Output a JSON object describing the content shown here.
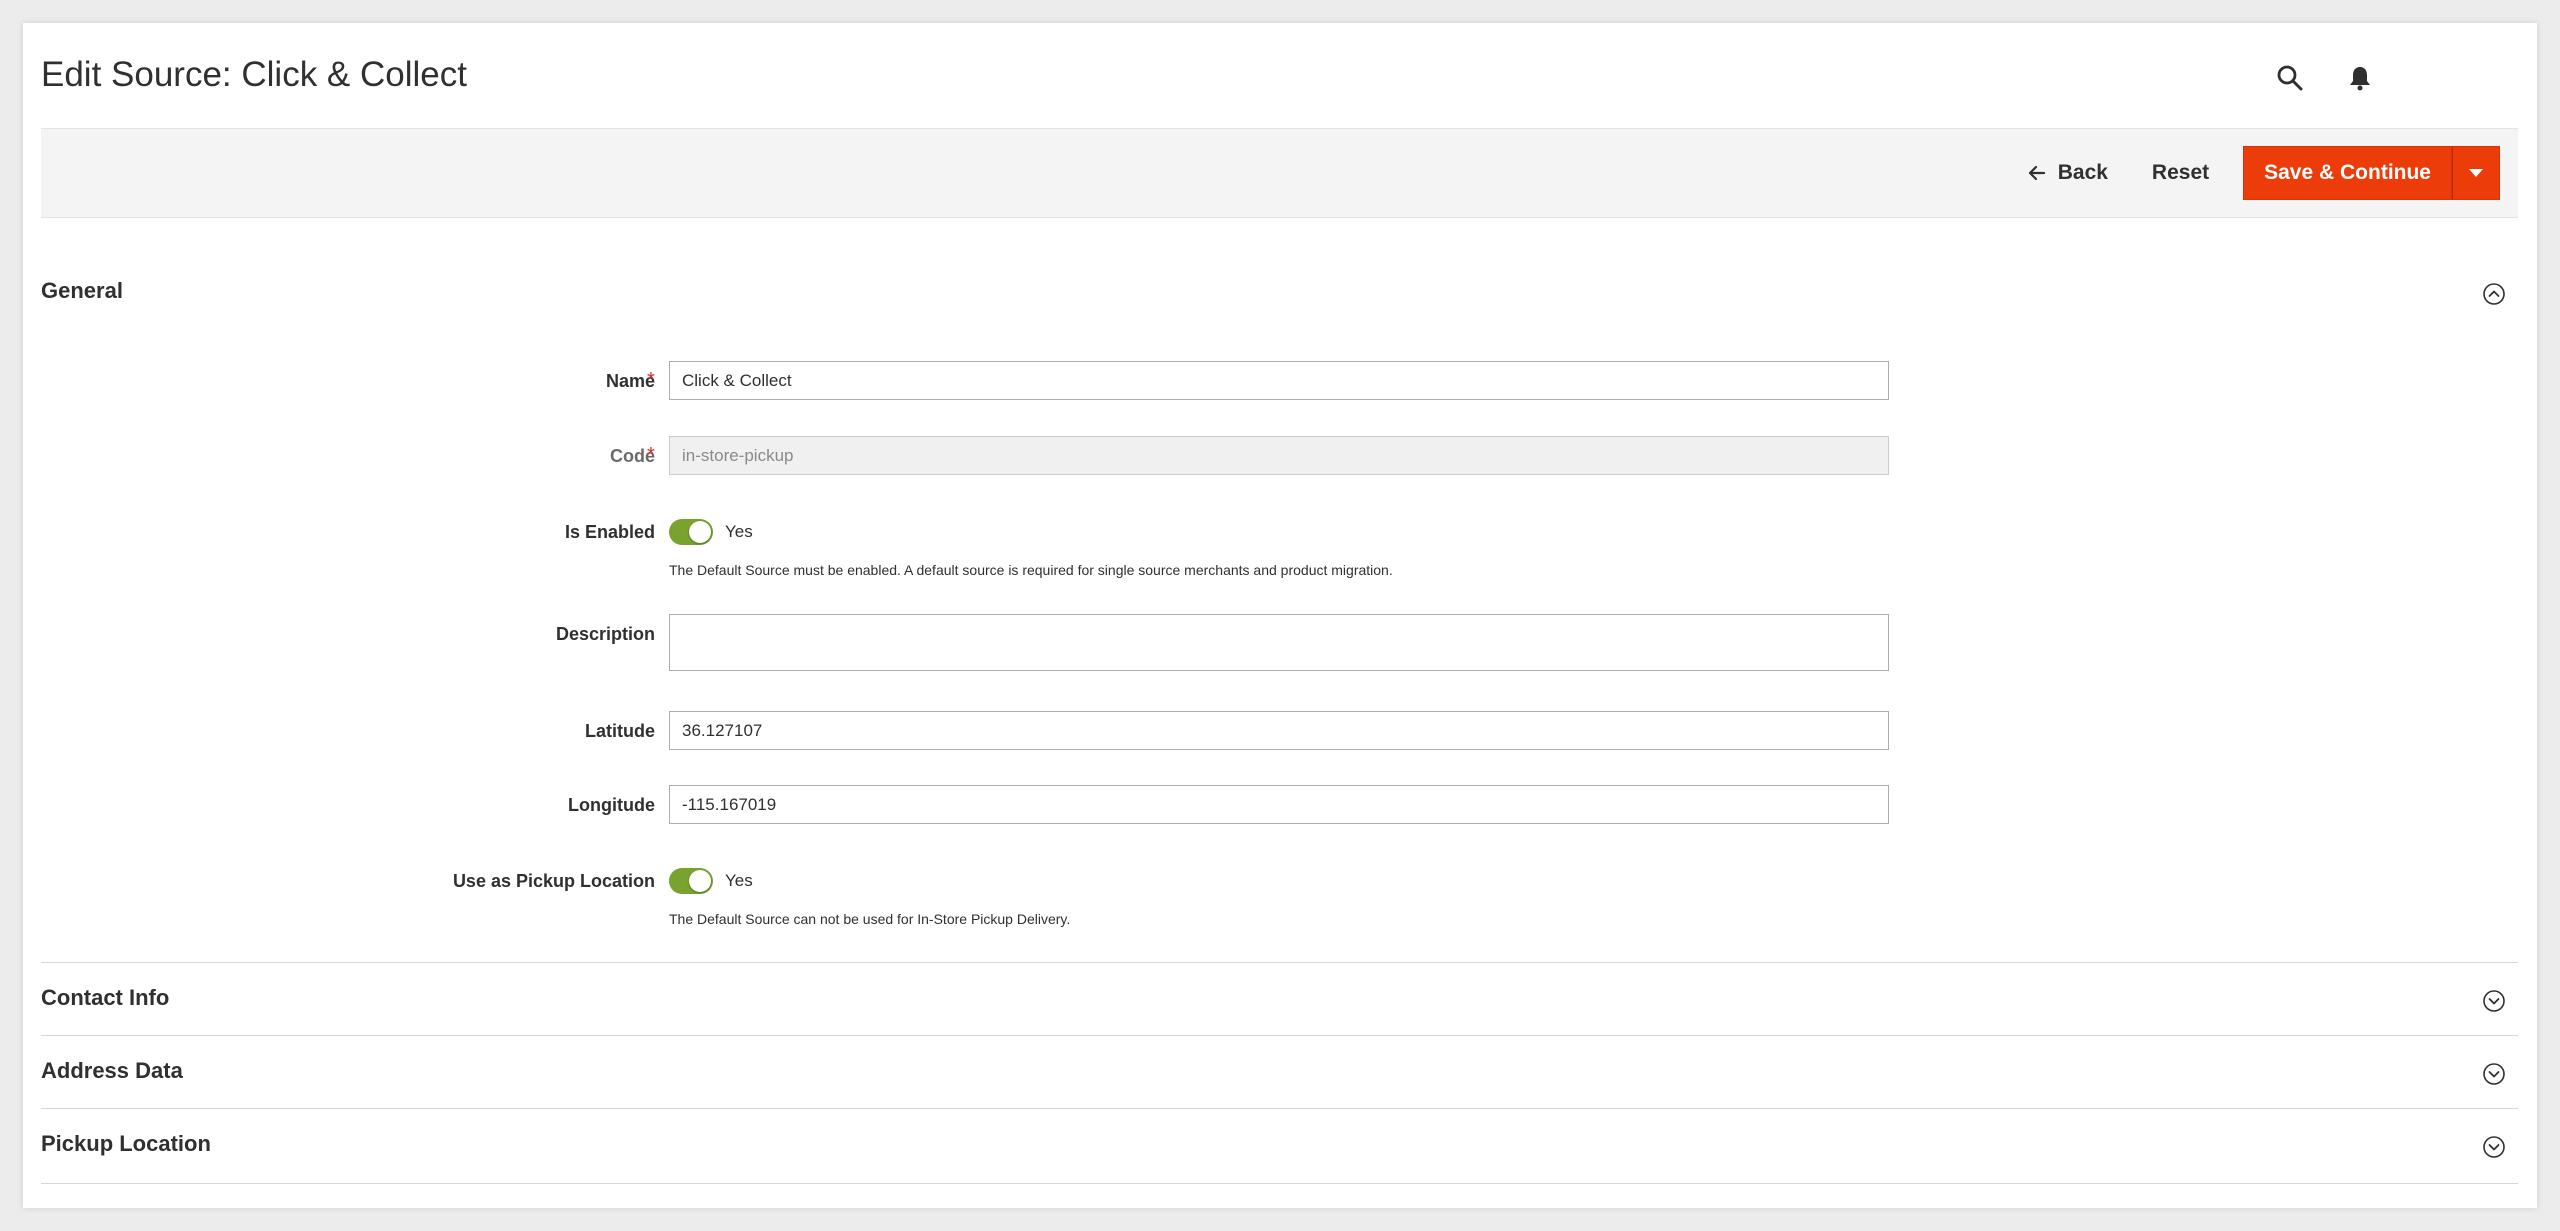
{
  "header": {
    "title": "Edit Source: Click & Collect",
    "icons": [
      "search-icon",
      "bell-icon"
    ]
  },
  "actions": {
    "back_label": "Back",
    "reset_label": "Reset",
    "save_label": "Save & Continue",
    "primary_color": "#eb3c0a"
  },
  "general": {
    "title": "General",
    "fields": {
      "name_label": "Name",
      "name_value": "Click & Collect",
      "code_label": "Code",
      "code_value": "in-store-pickup",
      "enabled_label": "Is Enabled",
      "enabled_value": "Yes",
      "enabled_note": "The Default Source must be enabled. A default source is required for single source merchants and product migration.",
      "description_label": "Description",
      "description_value": "",
      "latitude_label": "Latitude",
      "latitude_value": "36.127107",
      "longitude_label": "Longitude",
      "longitude_value": "-115.167019",
      "pickup_label": "Use as Pickup Location",
      "pickup_value": "Yes",
      "pickup_note": "The Default Source can not be used for In-Store Pickup Delivery."
    },
    "toggle_color": "#79a22e"
  },
  "sections": {
    "contact": "Contact Info",
    "address": "Address Data",
    "pickup": "Pickup Location"
  }
}
